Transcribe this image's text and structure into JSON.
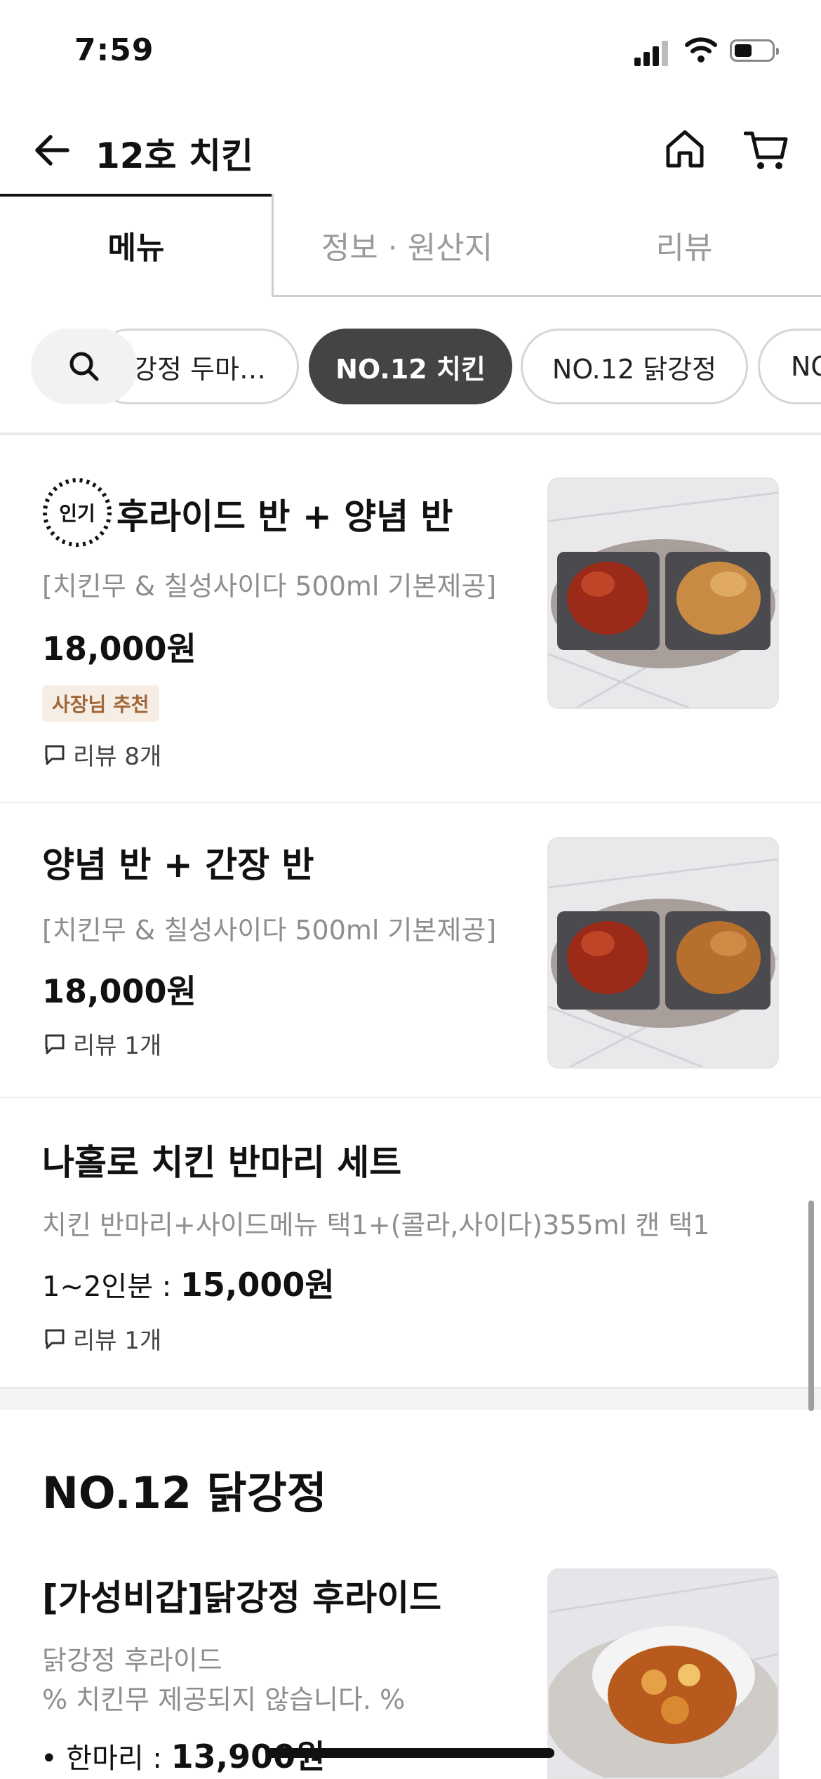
{
  "status_bar": {
    "time": "7:59"
  },
  "header": {
    "title": "12호 치킨"
  },
  "tabs": [
    {
      "label": "메뉴",
      "active": true
    },
    {
      "label": "정보 · 원산지",
      "active": false
    },
    {
      "label": "리뷰",
      "active": false
    }
  ],
  "categories": [
    {
      "label": "닭강정 두마…",
      "active": false
    },
    {
      "label": "NO.12 치킨",
      "active": true
    },
    {
      "label": "NO.12 닭강정",
      "active": false
    },
    {
      "label": "NO",
      "active": false
    }
  ],
  "menu_items": [
    {
      "badge_icon": "인기",
      "name": "후라이드 반 + 양념 반",
      "description": "[치킨무 & 칠성사이다 500ml  기본제공]",
      "price": "18,000원",
      "tag": "사장님 추천",
      "reviews": "리뷰 8개"
    },
    {
      "name": "양념 반 + 간장 반",
      "description": "[치킨무 & 칠성사이다 500ml  기본제공]",
      "price": "18,000원",
      "reviews": "리뷰 1개"
    },
    {
      "name": "나홀로  치킨 반마리 세트",
      "description": "치킨 반마리+사이드메뉴 택1+(콜라,사이다)355ml 캔 택1",
      "price_prefix": "1~2인분 : ",
      "price": "15,000원",
      "reviews": "리뷰 1개"
    }
  ],
  "section": {
    "title": "NO.12 닭강정",
    "item": {
      "name": "[가성비갑]닭강정 후라이드",
      "description_line1": "닭강정 후라이드",
      "description_line2": "% 치킨무 제공되지 않습니다. %",
      "price_prefix": "• 한마리 : ",
      "price": "13,900원"
    }
  },
  "colors": {
    "active_chip": "#444444",
    "badge_text": "#a0673a",
    "badge_bg": "#f6ede4"
  }
}
